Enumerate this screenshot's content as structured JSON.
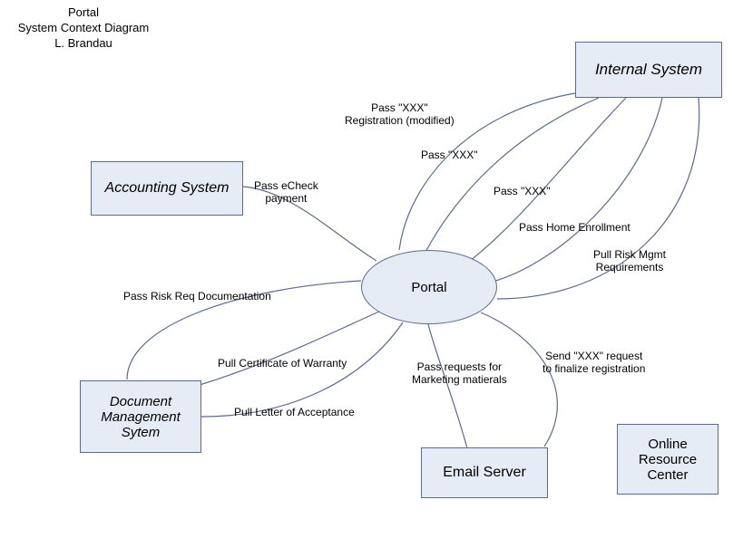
{
  "title": {
    "line1": "Portal",
    "line2": "System Context Diagram",
    "author": "L. Brandau"
  },
  "nodes": {
    "portal": "Portal",
    "accounting": "Accounting System",
    "internal": "Internal System",
    "dms": "Document\nManagement\nSytem",
    "email": "Email Server",
    "orc": "Online\nResource\nCenter"
  },
  "edges": {
    "pass_echeck": "Pass eCheck\npayment",
    "pass_reg": "Pass \"XXX\"\nRegistration (modified)",
    "pass_xxx1": "Pass \"XXX\"",
    "pass_xxx2": "Pass \"XXX\"",
    "pass_home": "Pass Home Enrollment",
    "pull_risk": "Pull Risk Mgmt\nRequirements",
    "pass_risk_doc": "Pass Risk Req Documentation",
    "pull_cert": "Pull Certificate of Warranty",
    "pull_letter": "Pull Letter of Acceptance",
    "pass_marketing": "Pass requests for\nMarketing matierals",
    "send_request": "Send \"XXX\" request\nto finalize registration"
  },
  "colors": {
    "fill": "#e6ecf5",
    "stroke": "#5a6b8c"
  }
}
